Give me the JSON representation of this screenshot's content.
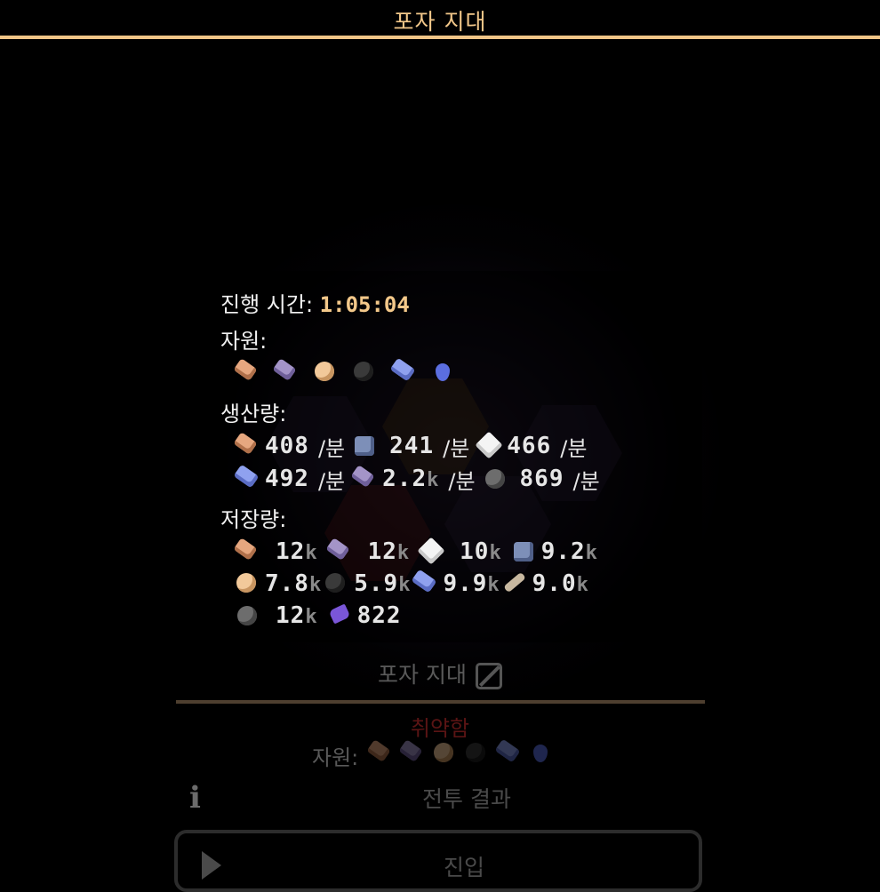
{
  "header": {
    "title": "포자 지대"
  },
  "tooltip": {
    "elapsed_label": "진행 시간: ",
    "elapsed_value": "1:05:04",
    "resources_label": "자원:",
    "resources": [
      "copper-icon",
      "lead-icon",
      "sand-icon",
      "coal-icon",
      "titanium-icon",
      "water-icon"
    ],
    "production_label": "생산량:",
    "production": [
      {
        "icon": "copper-icon",
        "value": "408",
        "unit": "/분"
      },
      {
        "icon": "graphite-icon",
        "value": "241",
        "unit": "/분"
      },
      {
        "icon": "silicon-icon",
        "value": "466",
        "unit": "/분"
      },
      {
        "icon": "titanium-icon",
        "value": "492",
        "unit": "/분"
      },
      {
        "icon": "lead-icon",
        "value": "2.2",
        "suffix": "k",
        "unit": "/분"
      },
      {
        "icon": "scrap-icon",
        "value": "869",
        "unit": "/분"
      }
    ],
    "storage_label": "저장량:",
    "storage": [
      {
        "icon": "copper-icon",
        "value": "12",
        "suffix": "k"
      },
      {
        "icon": "lead-icon",
        "value": "12",
        "suffix": "k"
      },
      {
        "icon": "silicon-icon",
        "value": "10",
        "suffix": "k"
      },
      {
        "icon": "graphite-icon",
        "value": "9.2",
        "suffix": "k"
      },
      {
        "icon": "sand-icon",
        "value": "7.8",
        "suffix": "k"
      },
      {
        "icon": "coal-icon",
        "value": "5.9",
        "suffix": "k"
      },
      {
        "icon": "titanium-icon",
        "value": "9.9",
        "suffix": "k"
      },
      {
        "icon": "beryllium-icon",
        "value": "9.0",
        "suffix": "k"
      },
      {
        "icon": "scrap-icon",
        "value": "12",
        "suffix": "k"
      },
      {
        "icon": "spore-pod-icon",
        "value": "822",
        "suffix": ""
      }
    ]
  },
  "sector": {
    "name": "포자 지대",
    "threat": "취약함",
    "resources_label": "자원:",
    "battle_results": "전투 결과",
    "enter": "진입"
  },
  "colors": {
    "accent": "#f0c587",
    "threat": "#5a1414"
  }
}
